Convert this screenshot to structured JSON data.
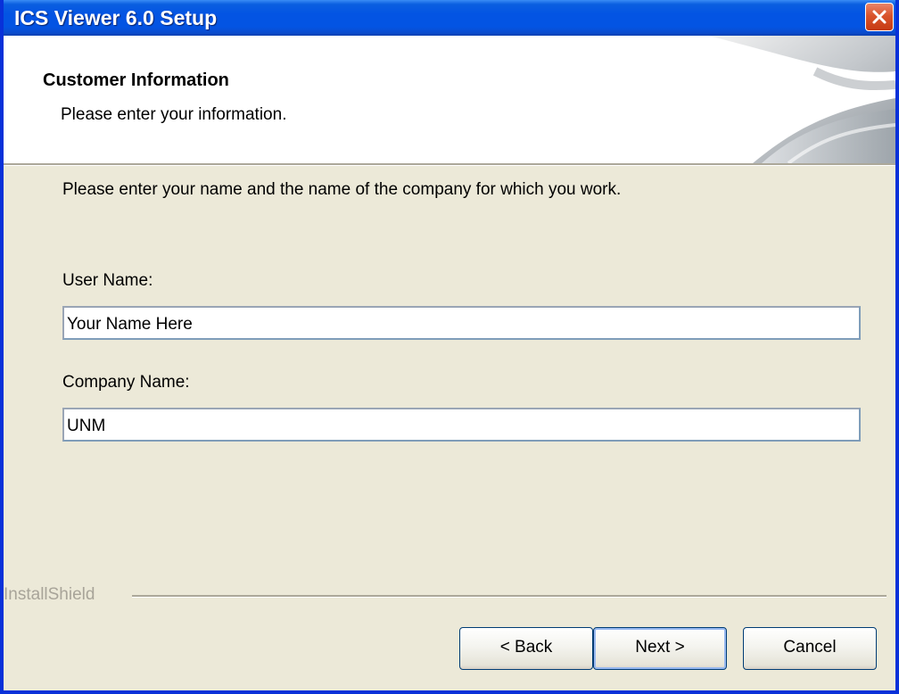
{
  "window": {
    "title": "ICS Viewer 6.0 Setup",
    "close_icon": "close-icon"
  },
  "header": {
    "title": "Customer Information",
    "subtitle": "Please enter your information."
  },
  "body": {
    "instructions": "Please enter your name and the name of the company for which you work.",
    "user_name_label": "User Name:",
    "user_name_value": "Your Name Here",
    "company_name_label": "Company Name:",
    "company_name_value": "UNM"
  },
  "footer": {
    "brand": "InstallShield",
    "back_label": "< Back",
    "next_label": "Next >",
    "cancel_label": "Cancel"
  },
  "colors": {
    "titlebar": "#0354e3",
    "window_border": "#0831d9",
    "dialog_bg": "#ece9d8",
    "close_button": "#d9542c"
  }
}
